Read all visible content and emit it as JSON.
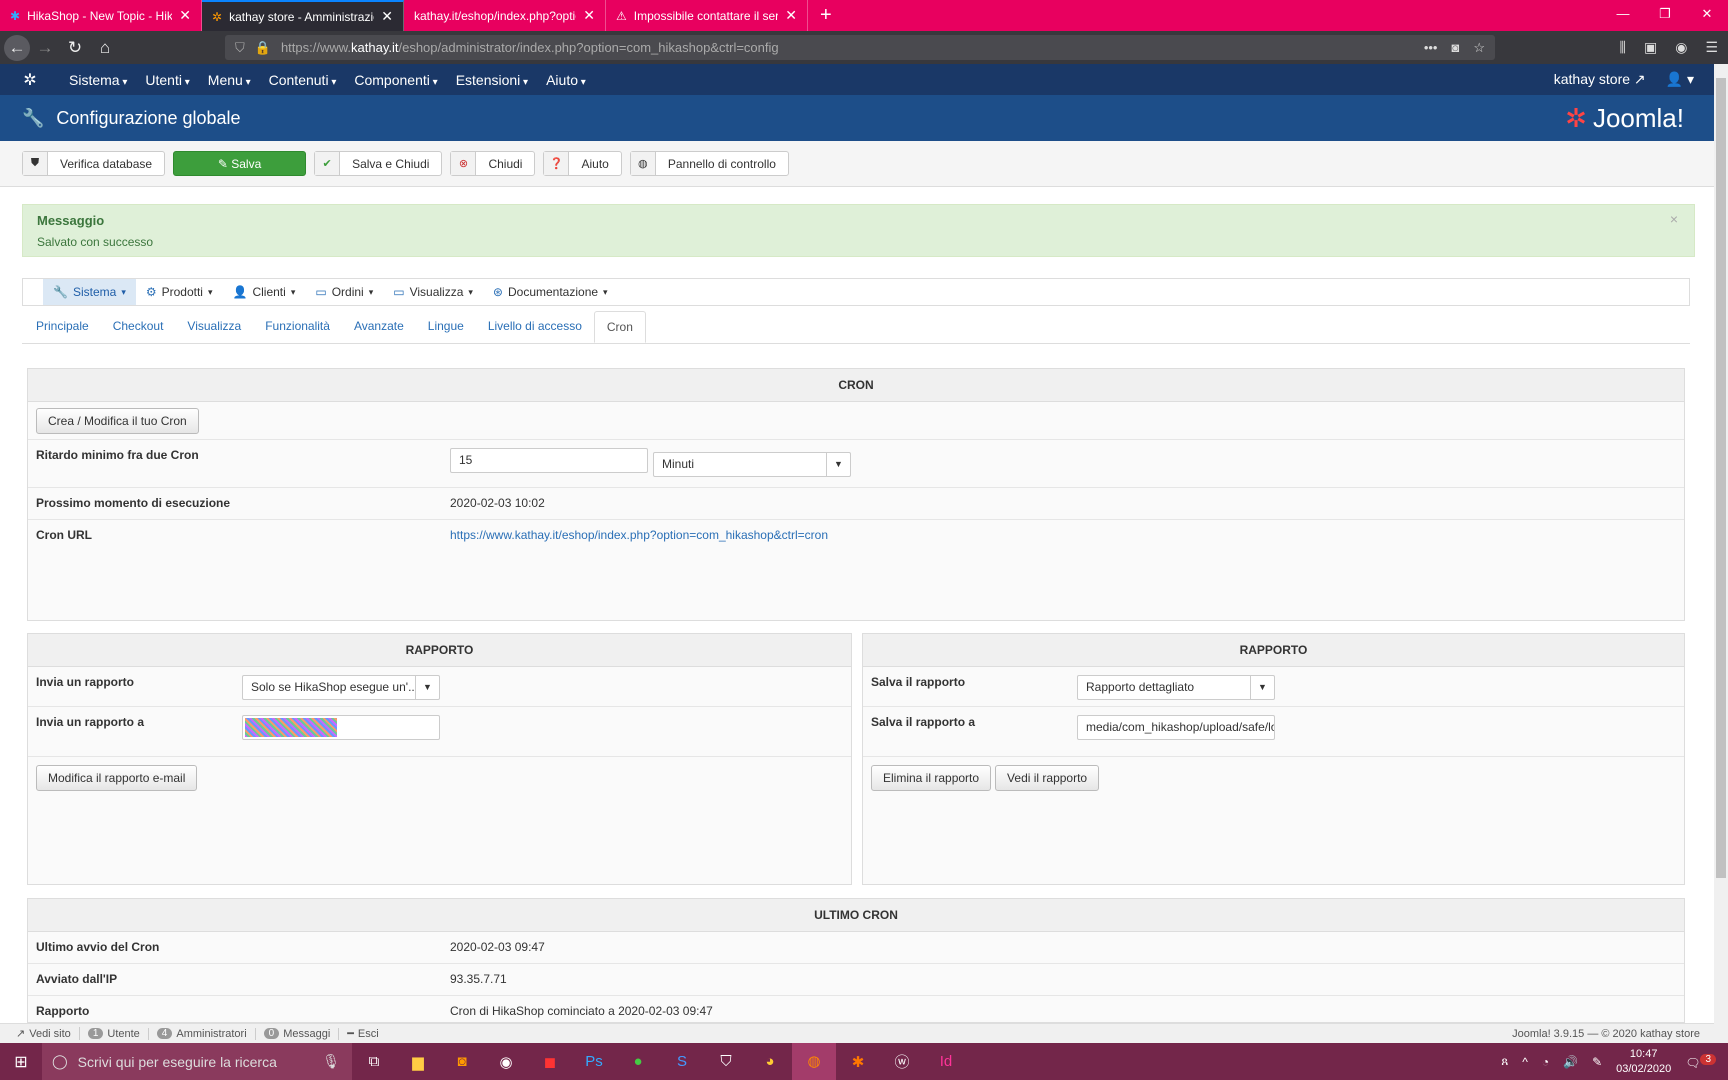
{
  "browser": {
    "tabs": [
      {
        "title": "HikaShop - New Topic - HikaSh",
        "icon": "hikashop-icon"
      },
      {
        "title": "kathay store - Amministrazione",
        "icon": "joomla-icon",
        "active": true
      },
      {
        "title": "kathay.it/eshop/index.php?option=",
        "icon": ""
      },
      {
        "title": "Impossibile contattare il server",
        "icon": "warning-icon"
      }
    ],
    "url_prefix": "https://www.",
    "url_domain": "kathay.it",
    "url_rest": "/eshop/administrator/index.php?option=com_hikashop&ctrl=config"
  },
  "joomla": {
    "menu": [
      "Sistema",
      "Utenti",
      "Menu",
      "Contenuti",
      "Componenti",
      "Estensioni",
      "Aiuto"
    ],
    "site_link": "kathay store",
    "page_title": "Configurazione globale",
    "brand": "Joomla!"
  },
  "toolbar": {
    "verify": "Verifica database",
    "save": "Salva",
    "save_close": "Salva e Chiudi",
    "close": "Chiudi",
    "help": "Aiuto",
    "control_panel": "Pannello di controllo"
  },
  "message": {
    "title": "Messaggio",
    "text": "Salvato con successo",
    "close": "×"
  },
  "hikamenu": [
    "Sistema",
    "Prodotti",
    "Clienti",
    "Ordini",
    "Visualizza",
    "Documentazione"
  ],
  "subtabs": [
    "Principale",
    "Checkout",
    "Visualizza",
    "Funzionalità",
    "Avanzate",
    "Lingue",
    "Livello di accesso",
    "Cron"
  ],
  "cron": {
    "title": "CRON",
    "create_btn": "Crea / Modifica il tuo Cron",
    "delay_label": "Ritardo minimo fra due Cron",
    "delay_value": "15",
    "delay_unit": "Minuti",
    "next_label": "Prossimo momento di esecuzione",
    "next_value": "2020-02-03 10:02",
    "url_label": "Cron URL",
    "url_value": "https://www.kathay.it/eshop/index.php?option=com_hikashop&ctrl=cron"
  },
  "report_left": {
    "title": "RAPPORTO",
    "send_label": "Invia un rapporto",
    "send_value": "Solo se HikaShop esegue un'...",
    "to_label": "Invia un rapporto a",
    "edit_btn": "Modifica il rapporto e-mail"
  },
  "report_right": {
    "title": "RAPPORTO",
    "save_label": "Salva il rapporto",
    "save_value": "Rapporto dettagliato",
    "to_label": "Salva il rapporto a",
    "to_value": "media/com_hikashop/upload/safe/lo",
    "delete_btn": "Elimina il rapporto",
    "view_btn": "Vedi il rapporto"
  },
  "last": {
    "title": "ULTIMO CRON",
    "start_label": "Ultimo avvio del Cron",
    "start_value": "2020-02-03 09:47",
    "ip_label": "Avviato dall'IP",
    "ip_value": "93.35.7.71",
    "report_label": "Rapporto",
    "report_value": "Cron di HikaShop cominciato a 2020-02-03 09:47"
  },
  "status": {
    "view_site": "Vedi sito",
    "users_count": "1",
    "users": "Utente",
    "admins_count": "4",
    "admins": "Amministratori",
    "msgs_count": "0",
    "msgs": "Messaggi",
    "logout": "Esci",
    "version": "Joomla! 3.9.15 — © 2020 kathay store"
  },
  "taskbar": {
    "search_placeholder": "Scrivi qui per eseguire la ricerca",
    "time": "10:47",
    "date": "03/02/2020",
    "notifications": "3"
  }
}
